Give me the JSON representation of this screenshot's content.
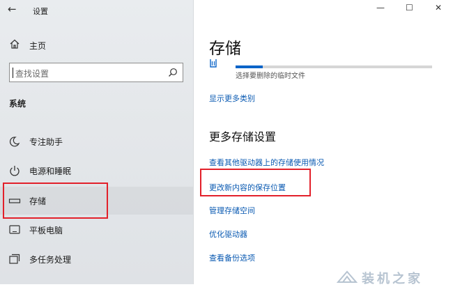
{
  "window": {
    "title": "设置",
    "buttons": {
      "minimize": "—",
      "maximize": "☐",
      "close": "✕"
    },
    "back_icon": "back-arrow-icon"
  },
  "sidebar": {
    "home_label": "主页",
    "search_placeholder": "查找设置",
    "section_label": "系统",
    "items": [
      {
        "label": "专注助手",
        "icon": "moon-icon"
      },
      {
        "label": "电源和睡眠",
        "icon": "power-icon"
      },
      {
        "label": "存储",
        "icon": "storage-drive-icon",
        "active": true
      },
      {
        "label": "平板电脑",
        "icon": "tablet-icon"
      },
      {
        "label": "多任务处理",
        "icon": "multitasking-icon"
      }
    ]
  },
  "content": {
    "title": "存储",
    "temp_files": {
      "label": "选择要删除的临时文件",
      "usage_fraction": 0.14
    },
    "show_more_link": "显示更多类别",
    "more_settings_title": "更多存储设置",
    "links": [
      "查看其他驱动器上的存储使用情况",
      "更改新内容的保存位置",
      "管理存储空间",
      "优化驱动器",
      "查看备份选项"
    ]
  },
  "colors": {
    "accent": "#0a64c8",
    "link": "#0a5ab2",
    "highlight": "#e2202a"
  },
  "watermark": {
    "text": "装机之家"
  }
}
